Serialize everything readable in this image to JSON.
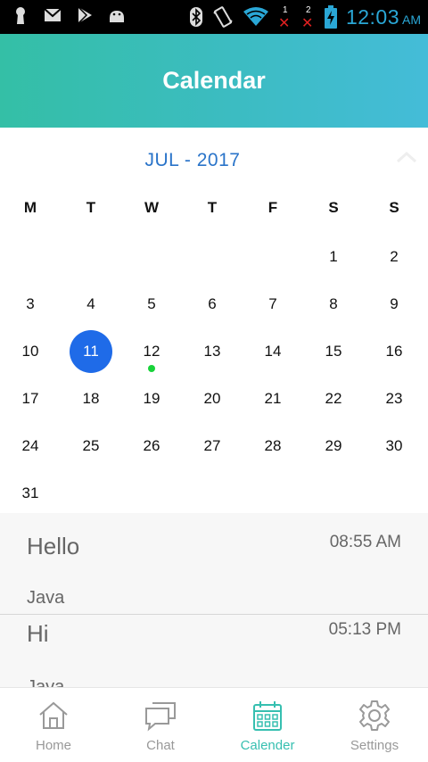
{
  "status_bar": {
    "icons_left": [
      "keyhole-icon",
      "gmail-icon",
      "play-store-icon",
      "android-icon"
    ],
    "icons_right": [
      "bluetooth-icon",
      "vibrate-icon",
      "wifi-icon",
      "sim1-no-signal-icon",
      "sim2-no-signal-icon",
      "battery-charging-icon"
    ],
    "sim1_label": "1",
    "sim2_label": "2",
    "time": "12:03",
    "ampm": "AM",
    "time_color": "#2aa7d6"
  },
  "header": {
    "title": "Calendar",
    "gradient": [
      "#34bfa6",
      "#44bcd8"
    ]
  },
  "calendar": {
    "month_label": "JUL - 2017",
    "weekdays": [
      "M",
      "T",
      "W",
      "T",
      "F",
      "S",
      "S"
    ],
    "weeks": [
      [
        "",
        "",
        "",
        "",
        "",
        "1",
        "2"
      ],
      [
        "3",
        "4",
        "5",
        "6",
        "7",
        "8",
        "9"
      ],
      [
        "10",
        "11",
        "12",
        "13",
        "14",
        "15",
        "16"
      ],
      [
        "17",
        "18",
        "19",
        "20",
        "21",
        "22",
        "23"
      ],
      [
        "24",
        "25",
        "26",
        "27",
        "28",
        "29",
        "30"
      ],
      [
        "31",
        "",
        "",
        "",
        "",
        "",
        ""
      ]
    ],
    "selected_day": "11",
    "event_dot_days": [
      "12"
    ],
    "selected_color": "#1f6be8",
    "dot_color": "#18d33a"
  },
  "events": [
    {
      "title": "Hello",
      "time": "08:55 AM",
      "subtitle": "Java"
    },
    {
      "title": "Hi",
      "time": "05:13 PM",
      "subtitle": "Java"
    }
  ],
  "bottom_nav": {
    "items": [
      {
        "label": "Home",
        "icon": "home-icon",
        "active": false
      },
      {
        "label": "Chat",
        "icon": "chat-icon",
        "active": false
      },
      {
        "label": "Calender",
        "icon": "calendar-icon",
        "active": true
      },
      {
        "label": "Settings",
        "icon": "gear-icon",
        "active": false
      }
    ],
    "active_color": "#36bfb0"
  }
}
